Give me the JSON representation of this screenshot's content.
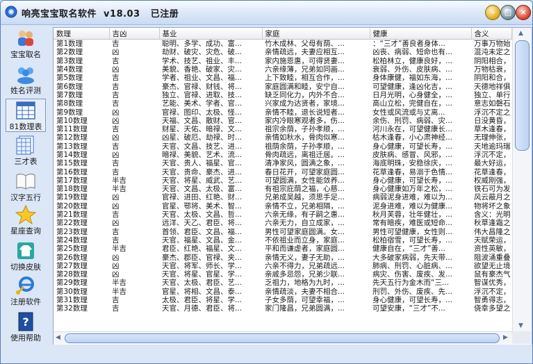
{
  "window": {
    "title": "响亮宝宝取名软件  v18.03   已注册"
  },
  "sidebar": {
    "items": [
      {
        "label": "宝宝取名",
        "icon": "people-icon"
      },
      {
        "label": "姓名评测",
        "icon": "users-icon"
      },
      {
        "label": "81数理表",
        "icon": "calendar-table-icon"
      },
      {
        "label": "三才表",
        "icon": "document-table-icon"
      },
      {
        "label": "汉字五行",
        "icon": "book-icon"
      },
      {
        "label": "星座查询",
        "icon": "star-icon"
      },
      {
        "label": "切换皮肤",
        "icon": "shirt-icon"
      },
      {
        "label": "注册软件",
        "icon": "ie-key-icon"
      },
      {
        "label": "使用帮助",
        "icon": "help-book-icon"
      }
    ],
    "active_index": 2
  },
  "table": {
    "headers": [
      "数理",
      "吉凶",
      "基业",
      "家庭",
      "健康",
      "含义"
    ],
    "rows": [
      [
        "第1数理",
        "吉",
        "聪明、多学、成功、富...",
        "竹木成林、父母有荫、...",
        "：“三才”善良者身体...",
        "万事万物始"
      ],
      [
        "第2数理",
        "凶",
        "劫财、破灾、灾危、破...",
        "亲情疏远，夫妻应相互...",
        "凶丧、病弱、短命也有...",
        "混沌未定之"
      ],
      [
        "第3数理",
        "吉",
        "学术、技艺、祖业、丰...",
        "家内施恩惠，可得贤妻...",
        "松柏林立，健康良好，...",
        "阴阳相合，"
      ],
      [
        "第4数理",
        "凶",
        "美貌、香艳、破家、灾...",
        "六亲缘薄，兄弟如同画...",
        "衰弱、外伤、皮肤病、...",
        "万物枯衰，"
      ],
      [
        "第5数理",
        "吉",
        "学者、祖业、文昌、福...",
        "上下致睦，相互合作，...",
        "身体康健，福如东海，...",
        "阴阳和合，"
      ],
      [
        "第6数理",
        "吉",
        "豪杰、官禄、财钱、将...",
        "家庭圆满和睦，安宁自...",
        "可望健康，逢凶化吉，...",
        "天德地祥俱"
      ],
      [
        "第7数理",
        "吉",
        "独立、官禄、进取、技...",
        "缺乏同化力，内外不合...",
        "日月光明，心身健全，...",
        "独立、单行"
      ],
      [
        "第8数理",
        "吉",
        "艺能、美术、学者、官...",
        "兴家成为达贤者，家境...",
        "高山立松，完健自在，...",
        "意志如磐石"
      ],
      [
        "第9数理",
        "凶",
        "官禄、图印、太极、怪...",
        "亲情不睦，退长说短者...",
        "女性或风流或与丈离...",
        "浮沉不定之"
      ],
      [
        "第10数理",
        "凶",
        "天福、文昌、散财、官...",
        "家内冷眼寒观者多，伤...",
        "余伤、刑罚、病弱、灾...",
        "日没黄昏，"
      ],
      [
        "第11数理",
        "吉",
        "财星、天佑、暗禄、文...",
        "祖宗余荫，子孙孝顺，...",
        "河川永在，可望健康长...",
        "草木逢春，"
      ],
      [
        "第12数理",
        "凶",
        "凶星、破厄、劫禄、时...",
        "亲情如秋水，骨肉似寒...",
        "枯木逢春，小心肃神经...",
        "无理伸张，"
      ],
      [
        "第13数理",
        "吉",
        "天官、文昌、技艺、进...",
        "祖荫余荫，子孙孝顺，...",
        "身心健康，可望长寿，...",
        "天地逾玛瑞"
      ],
      [
        "第14数理",
        "凶",
        "暗禄、美貌、艺术、流...",
        "骨肉疏远，离祖迁居。...",
        "皮肤病、感冒、风邪，...",
        "浮沉不定，"
      ],
      [
        "第15数理",
        "吉",
        "天官、贵人、福星、官...",
        "清净家风，圆满之象，...",
        "海底明珠，安稳徐庆，...",
        "最大好运，"
      ],
      [
        "第16数理",
        "吉",
        "天官、贵命、豪杰、进...",
        "春日花开，可望家庭圆...",
        "花草逢春，易溺于色情...",
        "花草逢春，"
      ],
      [
        "第17数理",
        "半吉",
        "天官、将星、威武、艺...",
        "可望圆满，女性能敛养...",
        "身心健康，可望长寿，...",
        "权威刚强，"
      ],
      [
        "第18数理",
        "半吉",
        "天官、文昌、太极、富...",
        "有祖宗庇荫之福，心慈...",
        "身心健康如万年之松，...",
        "铁石可为发"
      ],
      [
        "第19数理",
        "凶",
        "官禄、进田、红艳、财...",
        "兄弟成吴越，须思手足...",
        "病弱泥身进难，难以为...",
        "风云蔽月之"
      ],
      [
        "第20数理",
        "凶",
        "官星、鄂将、美术、智...",
        "亲情不立，兄弟相隔，...",
        "泥身进难，难以为健康...",
        "物将坏之象"
      ],
      [
        "第21数理",
        "吉",
        "天官、太极、文昌、哲...",
        "六亲无缘，有子嗣之惠...",
        "秋月芙蓉，壮年健壮，...",
        "含义：光明"
      ],
      [
        "第22数理",
        "凶",
        "远洋、天乙、君臣、将...",
        "六亲无力，自立成家，...",
        "常有暗疾，难医或短命...",
        "秋草逢霜之"
      ],
      [
        "第23数理",
        "吉",
        "首领、君臣、文昌、福...",
        "男性可望家庭圆满。女...",
        "男性可望健康，女性则...",
        "伟大昌隆之"
      ],
      [
        "第24数理",
        "吉",
        "天官、福星、文昌、金...",
        "不依祖业而立身，家庭...",
        "松柏宿雪，可望长寿，...",
        "天赋荣运，"
      ],
      [
        "第25数理",
        "半吉",
        "君臣、红艳、福星、文...",
        "平和而谦虚者，家庭圆...",
        "健康自在，“三才”善...",
        "资性英敏，"
      ],
      [
        "第26数理",
        "凶",
        "豪杰、郡臣、官禄、夹...",
        "亲情无义，妻子无助，...",
        "大多破家病弱，先天带...",
        "阻波涌重叠"
      ],
      [
        "第27数理",
        "凶",
        "天官、将军、师长、学...",
        "六亲不得力，兄弟疏远...",
        "肺病、刑罚、心脏病、...",
        "欲望无止境"
      ],
      [
        "第28数理",
        "凶",
        "天官、将星、官星、学...",
        "亲戚多忌怨，兄弟少联...",
        "病灾、伤害、废疾、发...",
        "鼠有豪杰气"
      ],
      [
        "第29数理",
        "半吉",
        "天官、太极、君臣、艺...",
        "乏祖力，地格为九时，...",
        "先天五行为金木而“三...",
        "智谋优秀，"
      ],
      [
        "第30数理",
        "半吉",
        "官星、将相、文昌、泰...",
        "亲情疏淡，夫妻不相合...",
        "刑罚、外伤、废疾、先...",
        "浮沉不定，"
      ],
      [
        "第31数理",
        "吉",
        "太极、君臣、将星、学...",
        "子女多荫，可望幸福，...",
        "身心健康，可望长寿，...",
        "智勇得志，"
      ],
      [
        "第32数理",
        "吉",
        "天官、月德、君臣、将...",
        "家门隆昌，兄弟圆满，...",
        "可望安康，“三才”不...",
        "侥幸多望之"
      ]
    ]
  }
}
